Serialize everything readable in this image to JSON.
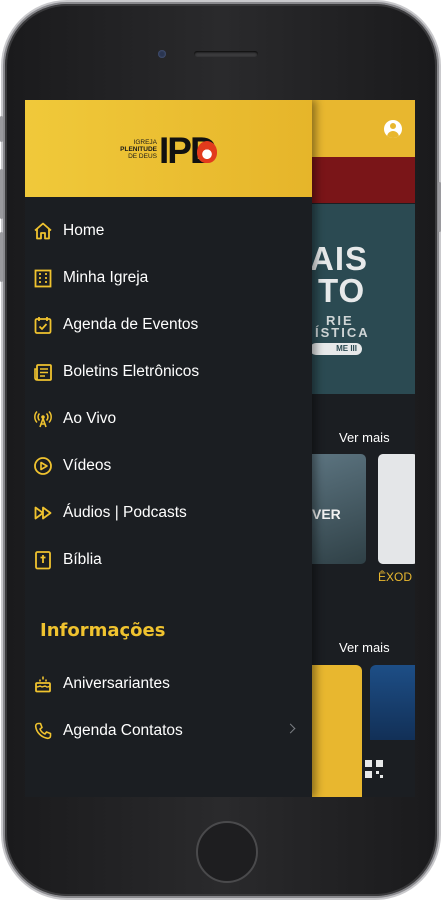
{
  "colors": {
    "accent": "#f0c32f",
    "drawer_bg": "#1b1e22",
    "header_bg": "#e8b72f",
    "band_red": "#7a1518"
  },
  "logo": {
    "small_line1": "IGREJA",
    "small_line2": "PLENITUDE",
    "small_line3": "DE DEUS",
    "big": "IPD"
  },
  "menu": [
    {
      "label": "Home",
      "icon": "home-icon"
    },
    {
      "label": "Minha Igreja",
      "icon": "building-icon"
    },
    {
      "label": "Agenda de Eventos",
      "icon": "calendar-check-icon"
    },
    {
      "label": "Boletins Eletrônicos",
      "icon": "newspaper-icon"
    },
    {
      "label": "Ao Vivo",
      "icon": "broadcast-icon"
    },
    {
      "label": "Vídeos",
      "icon": "play-circle-icon"
    },
    {
      "label": "Áudios | Podcasts",
      "icon": "fast-forward-icon"
    },
    {
      "label": "Bíblia",
      "icon": "bible-icon"
    }
  ],
  "info_section": {
    "title": "Informações",
    "items": [
      {
        "label": "Aniversariantes",
        "icon": "cake-icon"
      },
      {
        "label": "Agenda Contatos",
        "icon": "phone-icon"
      }
    ]
  },
  "background": {
    "banner_line1": "AIS",
    "banner_line2": "TO",
    "banner_line3": "RIE",
    "banner_line4": "ÍSTICA",
    "banner_pill": "ME III",
    "see_more_1": "Ver mais",
    "see_more_2": "Ver mais",
    "card1_text": "VER",
    "card2_caption": "ÊXOD"
  }
}
